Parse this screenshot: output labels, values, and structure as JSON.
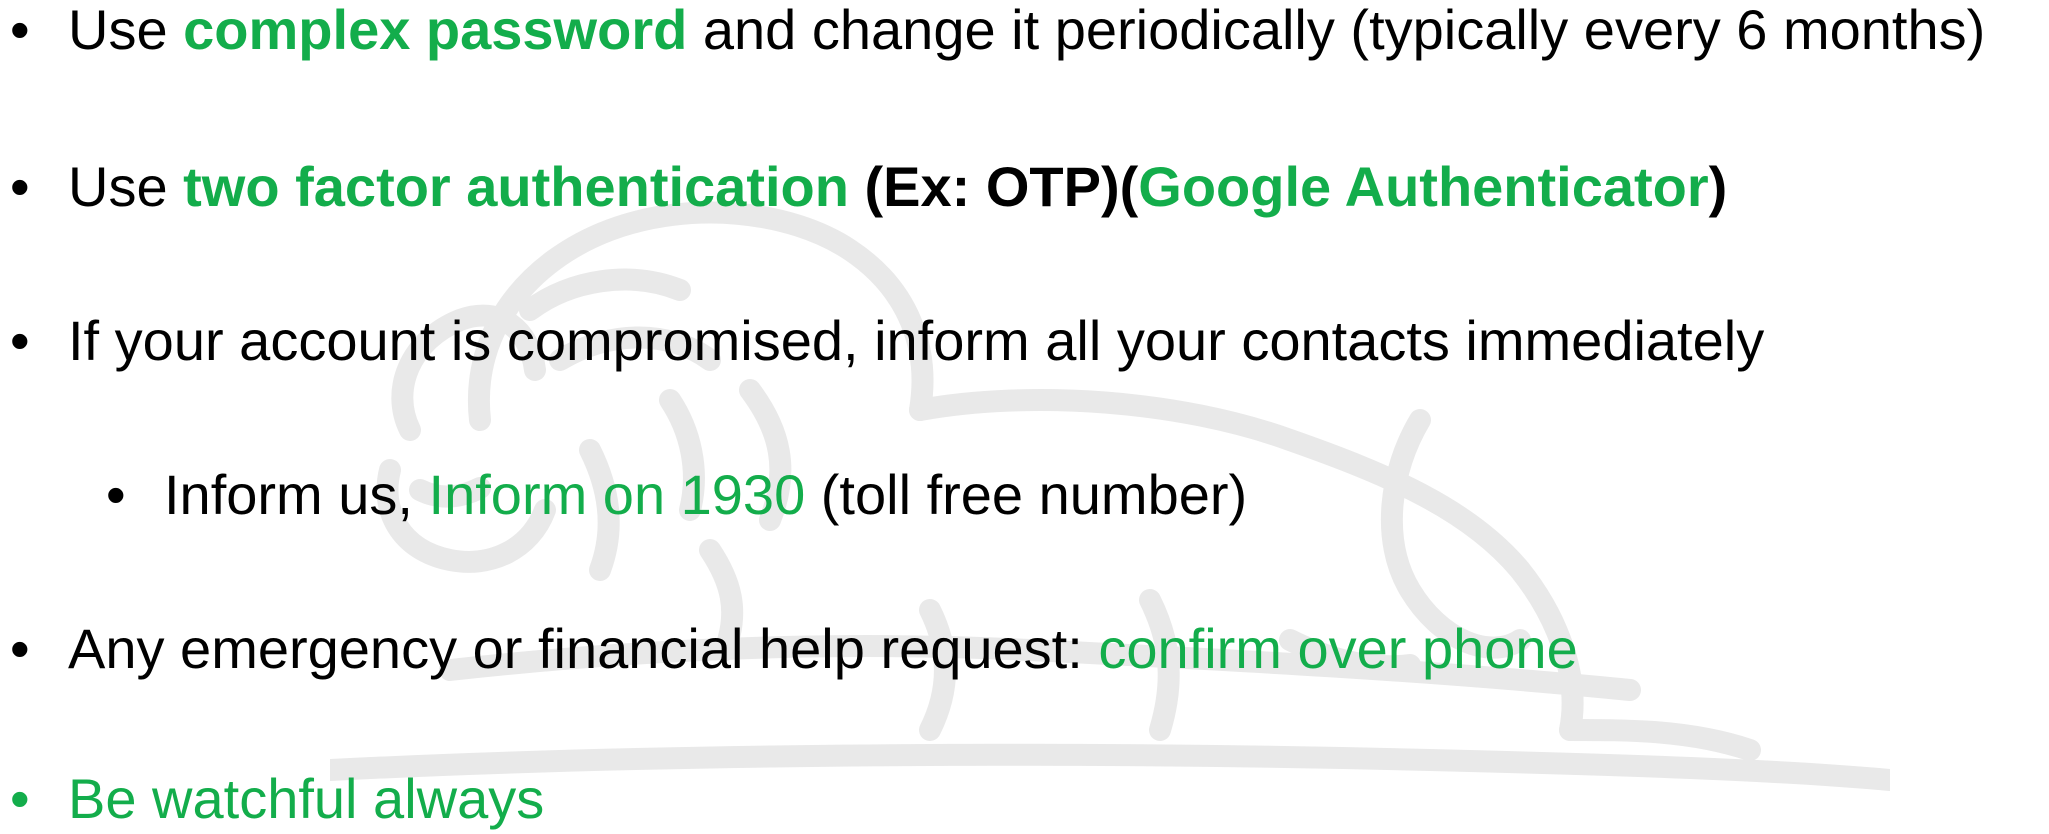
{
  "bullet_glyph": "•",
  "colors": {
    "text": "#000000",
    "accent_green": "#13ad4b",
    "watermark": "#e9e9e9",
    "background": "#ffffff"
  },
  "watermark": {
    "icon": "lion-watermark-icon"
  },
  "items": [
    {
      "parts": [
        "Use ",
        "complex password",
        " and change it periodically (typically every 6 months)"
      ]
    },
    {
      "parts": [
        "Use ",
        "two factor authentication",
        " (Ex: OTP)(",
        "Google Authenticator",
        ")"
      ]
    },
    {
      "parts": [
        "If your account is compromised, inform all your contacts immediately"
      ]
    },
    {
      "parts": [
        "Inform us, ",
        "Inform on 1930",
        " (toll free number)"
      ]
    },
    {
      "parts": [
        "Any emergency or financial help request: ",
        "confirm over phone"
      ]
    },
    {
      "parts": [
        "Be watchful always"
      ]
    }
  ]
}
